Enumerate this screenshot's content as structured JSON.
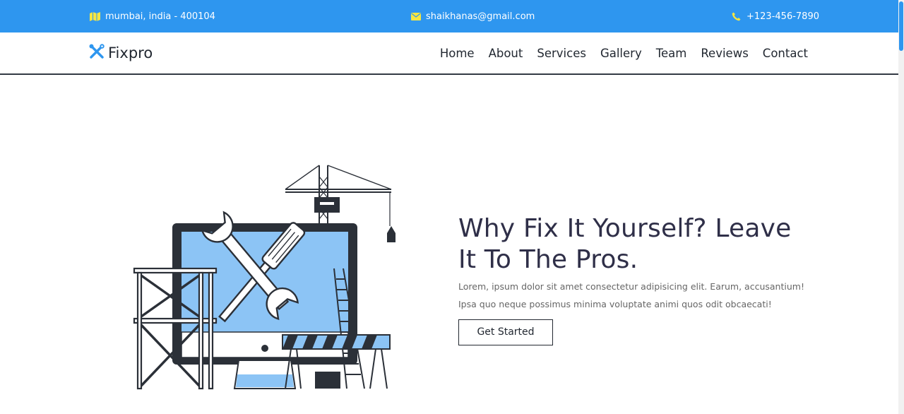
{
  "topbar": {
    "address": "mumbai, india - 400104",
    "email": "shaikhanas@gmail.com",
    "phone": "+123-456-7890",
    "icons": [
      "map-icon",
      "envelope-icon",
      "phone-icon"
    ],
    "icon_color": "#f5e642",
    "background": "#2e96ef"
  },
  "header": {
    "brand": "Fixpro",
    "brand_icon": "tools-icon",
    "nav": [
      "Home",
      "About",
      "Services",
      "Gallery",
      "Team",
      "Reviews",
      "Contact"
    ]
  },
  "hero": {
    "title": "Why Fix It Yourself? Leave It To The Pros.",
    "description": "Lorem, ipsum dolor sit amet consectetur adipisicing elit. Earum, accusantium! Ipsa quo neque possimus minima voluptate animi quos odit obcaecati!",
    "button_label": "Get Started",
    "illustration": "computer-repair-construction-illustration"
  },
  "colors": {
    "accent": "#2e96ef",
    "screen": "#8cc4f5",
    "dark": "#2b3038"
  }
}
